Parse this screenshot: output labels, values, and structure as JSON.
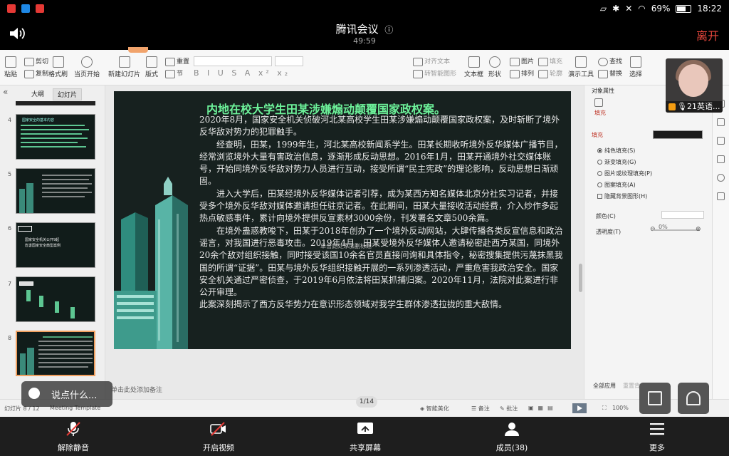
{
  "status": {
    "battery": "69%",
    "time": "18:22",
    "battery_level": 0.69
  },
  "meeting": {
    "title": "腾讯会议",
    "duration": "49:59",
    "leave_label": "离开"
  },
  "ribbon": {
    "paste": "粘贴",
    "cut": "剪切",
    "copy": "复制",
    "format_brush": "格式刷",
    "from_current": "当页开始",
    "new_slide": "新建幻灯片",
    "layout": "版式",
    "section": "节",
    "reset": "重置",
    "align_text": "对齐文本",
    "smart_graphic": "转智能图形",
    "textbox": "文本框",
    "shape": "形状",
    "picture": "图片",
    "arrange": "排列",
    "fill": "填充",
    "outline": "轮廓",
    "presenter_tools": "演示工具",
    "find": "查找",
    "replace": "替换",
    "select": "选择"
  },
  "left_panel": {
    "tab_outline": "大纲",
    "tab_slides": "幻灯片",
    "slide_numbers": [
      "4",
      "5",
      "6",
      "7",
      "8"
    ]
  },
  "thumbs": {
    "t4_title": "国家安全的基本内容",
    "t6_line1": "国家安全机关公开9起",
    "t6_line2": "危害国家安全典型案例"
  },
  "slide": {
    "title": "内地在校大学生田某涉嫌煽动颠覆国家政权案。",
    "paragraphs": [
      "2020年8月，国家安全机关侦破河北某高校学生田某涉嫌煽动颠覆国家政权案，及时斩断了境外反华敌对势力的犯罪触手。",
      "　　经查明，田某，1999年生，河北某高校新闻系学生。田某长期收听境外反华媒体广播节目，经常浏览境外大量有害政治信息，逐渐形成反动思想。2016年1月，田某开通境外社交媒体账号，开始同境外反华敌对势力人员进行互动，接受所谓“民主宪政”的理论影响，反动思想日渐顽固。",
      "　　进入大学后，田某经境外反华媒体记者引荐，成为某西方知名媒体北京分社实习记者，并接受多个境外反华敌对媒体邀请担任驻京记者。在此期间，田某大量接收活动经费，介入炒作多起热点敏感事件，累计向境外提供反宣素材3000余份，刊发署名文章500余篇。",
      "　　在境外蛊惑教唆下，田某于2018年创办了一个境外反动网站，大肆传播各类反宣信息和政治谣言，对我国进行恶毒攻击。2019年4月，田某受境外反华媒体人邀请秘密赴西方某国，同境外20余个敌对组织接触，同时接受该国10余名官员直接问询和具体指令，秘密搜集提供污蔑抹黑我国的所谓“证据”。田某与境外反华组织接触开展的一系列渗透活动，严重危害我政治安全。国家安全机关通过严密侦查，于2019年6月依法将田某抓捕归案。2020年11月，法院对此案进行非公开审理。",
      "此案深刻揭示了西方反华势力在意识形态领域对我学生群体渗透拉拢的重大敌情。"
    ],
    "subtitle_hint": "单击此处添加副标题"
  },
  "notes_hint": "单击此处添加备注",
  "right_panel": {
    "header": "对象属性",
    "tab_fill": "填充",
    "fill_heading": "填充",
    "fill_color": "#1a1a1a",
    "options": [
      "纯色填充(S)",
      "渐变填充(G)",
      "图片或纹理填充(P)",
      "图案填充(A)"
    ],
    "hide_bg": "隐藏背景图形(H)",
    "color_label": "颜色(C)",
    "transparency_label": "透明度(T)",
    "transparency_value": "0%",
    "apply_all": "全部应用",
    "reset_bg": "重置背"
  },
  "app_status": {
    "slide_pos": "幻灯片 8 / 12",
    "template": "Meeting Template",
    "smart_beautify": "智能美化",
    "notes": "备注",
    "comments": "批注",
    "zoom": "100%"
  },
  "overlay": {
    "participant_name": "21英语...",
    "chat_placeholder": "说点什么...",
    "page_indicator": "1/14"
  },
  "toolbar": {
    "unmute": "解除静音",
    "start_video": "开启视频",
    "share_screen": "共享屏幕",
    "members": "成员(38)",
    "more": "更多"
  }
}
